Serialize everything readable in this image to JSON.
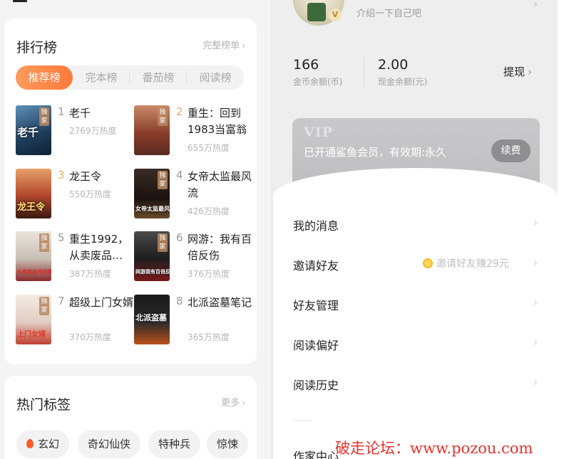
{
  "left": {
    "ranking": {
      "title": "排行榜",
      "more": "完整榜单",
      "tabs": [
        "推荐榜",
        "完本榜",
        "番茄榜",
        "阅读榜"
      ],
      "books": [
        {
          "rank": "1",
          "title": "老千",
          "heat": "2769万热度",
          "badge": "独家",
          "cover_text": "老千"
        },
        {
          "rank": "2",
          "title": "重生：回到1983当富翁",
          "heat": "655万热度",
          "badge": "独家",
          "cover_text": ""
        },
        {
          "rank": "3",
          "title": "龙王令",
          "heat": "550万热度",
          "badge": "",
          "cover_text": "龙王令"
        },
        {
          "rank": "4",
          "title": "女帝太监最风流",
          "heat": "426万热度",
          "badge": "独家",
          "cover_text": "女帝太监最风流"
        },
        {
          "rank": "5",
          "title": "重生1992，从卖废品…",
          "heat": "387万热度",
          "badge": "独家",
          "cover_text": "从卖废品开始致富"
        },
        {
          "rank": "6",
          "title": "网游：我有百倍反伤",
          "heat": "376万热度",
          "badge": "独家",
          "cover_text": "网游我有百倍反伤"
        },
        {
          "rank": "7",
          "title": "超级上门女婿",
          "heat": "370万热度",
          "badge": "独家",
          "cover_text": "上门女婿"
        },
        {
          "rank": "8",
          "title": "北派盗墓笔记",
          "heat": "365万热度",
          "badge": "",
          "cover_text": "北派盗墓"
        }
      ]
    },
    "tags": {
      "title": "热门标签",
      "more": "更多",
      "items": [
        "玄幻",
        "奇幻仙侠",
        "特种兵",
        "惊悚"
      ]
    }
  },
  "right": {
    "profile": {
      "intro": "介绍一下自己吧",
      "badge": "V"
    },
    "stats": [
      {
        "value": "166",
        "label": "金币余额(币)"
      },
      {
        "value": "2.00",
        "label": "现金余额(元)"
      }
    ],
    "withdraw": "提现",
    "vip": {
      "label": "VIP",
      "text": "已开通鲨鱼会员，有效期:永久",
      "renew": "续费"
    },
    "menu": [
      {
        "label": "我的消息",
        "hint": ""
      },
      {
        "label": "邀请好友",
        "hint": "邀请好友赚29元"
      },
      {
        "label": "好友管理",
        "hint": ""
      },
      {
        "label": "阅读偏好",
        "hint": ""
      },
      {
        "label": "阅读历史",
        "hint": ""
      },
      {
        "label": "作家中心",
        "hint": ""
      }
    ]
  },
  "watermark": "破走论坛：www.pozou.com",
  "colors": {
    "accent": "#ff8a4a",
    "watermark": "#e8322b",
    "rank_gold": "#e3b261"
  }
}
